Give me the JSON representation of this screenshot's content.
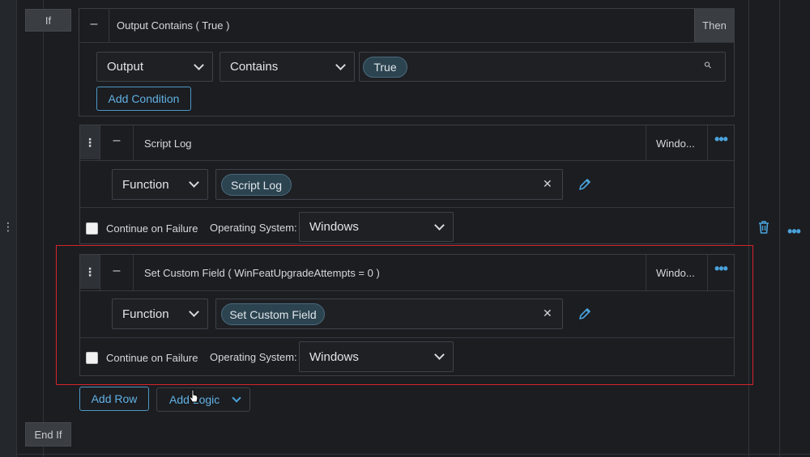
{
  "if_block": {
    "if_label": "If",
    "then_label": "Then",
    "end_if_label": "End If",
    "condition_title": "Output Contains ( True )",
    "condition": {
      "field": "Output",
      "operator": "Contains",
      "value_chip": "True"
    },
    "add_condition_label": "Add Condition"
  },
  "steps": [
    {
      "title": "Script Log",
      "os_short": "Windo...",
      "type_select": "Function",
      "function_chip": "Script Log",
      "continue_label": "Continue on Failure",
      "os_label": "Operating System:",
      "os_value": "Windows"
    },
    {
      "title": "Set Custom Field ( WinFeatUpgradeAttempts = 0 )",
      "os_short": "Windo...",
      "type_select": "Function",
      "function_chip": "Set Custom Field",
      "continue_label": "Continue on Failure",
      "os_label": "Operating System:",
      "os_value": "Windows"
    }
  ],
  "footer": {
    "add_row_label": "Add Row",
    "add_logic_label": "Add Logic"
  },
  "glyphs": {
    "minus": "–",
    "grip": "⋮",
    "more": "•••",
    "close": "✕",
    "search": "⚲"
  },
  "colors": {
    "accent": "#4aa3dc",
    "highlight_frame": "#d6232a"
  }
}
